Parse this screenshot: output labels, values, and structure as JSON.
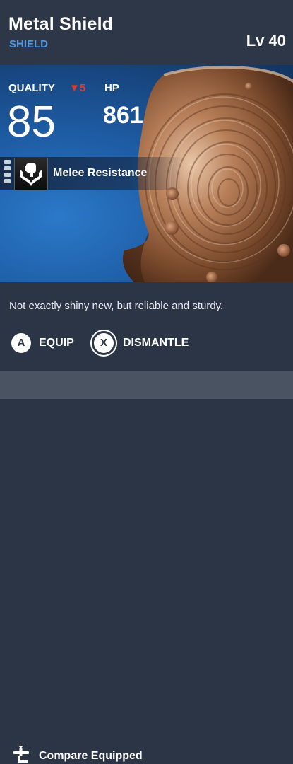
{
  "item": {
    "name": "Metal Shield",
    "type": "SHIELD",
    "level": "Lv 40"
  },
  "stats": {
    "quality_label": "QUALITY",
    "quality_delta": "5",
    "quality_value": "85",
    "hp_label": "HP",
    "hp_value": "861"
  },
  "perk": {
    "name": "Melee Resistance",
    "tier_filled": 4,
    "icon": "clenched-fist-emblem-icon"
  },
  "description": "Not exactly shiny new, but reliable and sturdy.",
  "actions": [
    {
      "button": "A",
      "label": "EQUIP"
    },
    {
      "button": "X",
      "label": "DISMANTLE"
    }
  ],
  "footer": {
    "icon": "compare-icon",
    "label": "Compare Equipped"
  },
  "colors": {
    "panel": "#2c3546",
    "accent_blue": "#4e9ae6",
    "delta_red": "#e03a2c",
    "footer": "#4a5362"
  }
}
